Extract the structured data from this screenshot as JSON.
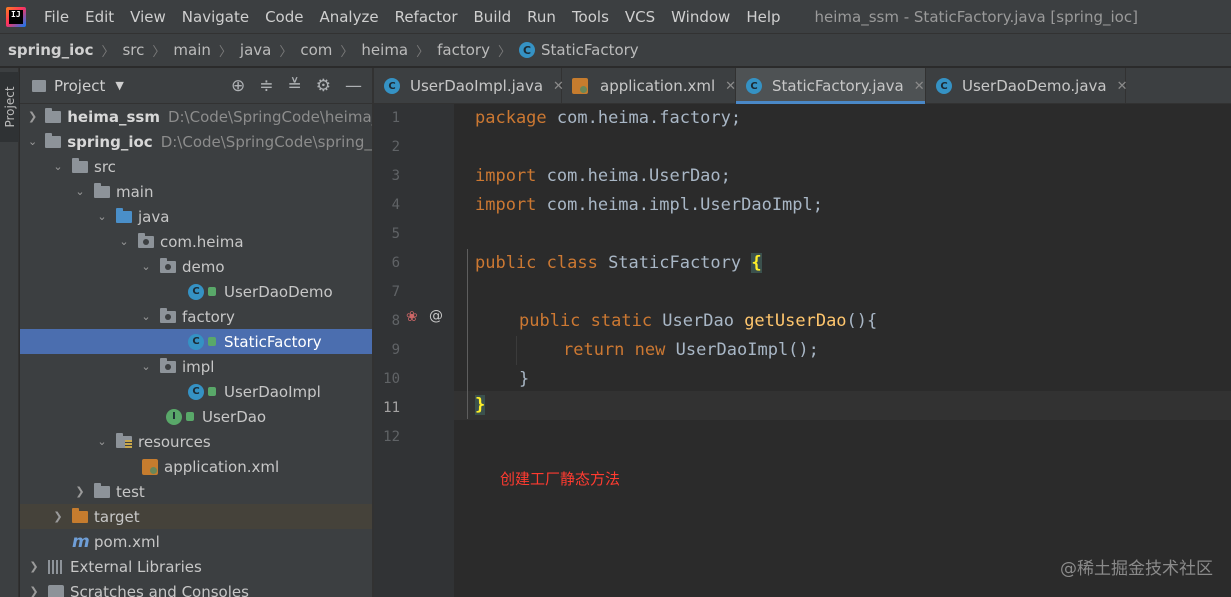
{
  "menubar": {
    "items": [
      "File",
      "Edit",
      "View",
      "Navigate",
      "Code",
      "Analyze",
      "Refactor",
      "Build",
      "Run",
      "Tools",
      "VCS",
      "Window",
      "Help"
    ],
    "window_title": "heima_ssm - StaticFactory.java [spring_ioc]"
  },
  "breadcrumb": {
    "items": [
      "spring_ioc",
      "src",
      "main",
      "java",
      "com",
      "heima",
      "factory",
      "StaticFactory"
    ]
  },
  "left_stripe": {
    "label": "Project"
  },
  "panel": {
    "title": "Project",
    "tree": [
      {
        "label": "heima_ssm",
        "path": "D:\\Code\\SpringCode\\heima_"
      },
      {
        "label": "spring_ioc",
        "path": "D:\\Code\\SpringCode\\spring_i"
      },
      {
        "label": "src"
      },
      {
        "label": "main"
      },
      {
        "label": "java"
      },
      {
        "label": "com.heima"
      },
      {
        "label": "demo"
      },
      {
        "label": "UserDaoDemo"
      },
      {
        "label": "factory"
      },
      {
        "label": "StaticFactory"
      },
      {
        "label": "impl"
      },
      {
        "label": "UserDaoImpl"
      },
      {
        "label": "UserDao"
      },
      {
        "label": "resources"
      },
      {
        "label": "application.xml"
      },
      {
        "label": "test"
      },
      {
        "label": "target"
      },
      {
        "label": "pom.xml"
      },
      {
        "label": "External Libraries"
      },
      {
        "label": "Scratches and Consoles"
      }
    ]
  },
  "tabs": [
    {
      "label": "UserDaoImpl.java"
    },
    {
      "label": "application.xml"
    },
    {
      "label": "StaticFactory.java"
    },
    {
      "label": "UserDaoDemo.java"
    }
  ],
  "editor": {
    "line_numbers": [
      "1",
      "2",
      "3",
      "4",
      "5",
      "6",
      "7",
      "8",
      "9",
      "10",
      "11",
      "12"
    ],
    "code": {
      "l1_kw": "package ",
      "l1_rest": "com.heima.factory;",
      "l3_kw": "import ",
      "l3_rest": "com.heima.UserDao;",
      "l4_kw": "import ",
      "l4_rest": "com.heima.impl.UserDaoImpl;",
      "l6_kw": "public class ",
      "l6_name": "StaticFactory ",
      "l6_brace": "{",
      "l8_kw": "public static ",
      "l8_type": "UserDao ",
      "l8_fn": "getUserDao",
      "l8_rest": "(){",
      "l9_kw": "return new ",
      "l9_rest": "UserDaoImpl();",
      "l10": "}",
      "l11": "}"
    },
    "annotation_note": "创建工厂静态方法"
  },
  "watermark": "@稀土掘金技术社区",
  "colors": {
    "keyword": "#cc7832",
    "function": "#ffc66d",
    "selection": "#4b6eaf",
    "note": "#ff3b30"
  }
}
